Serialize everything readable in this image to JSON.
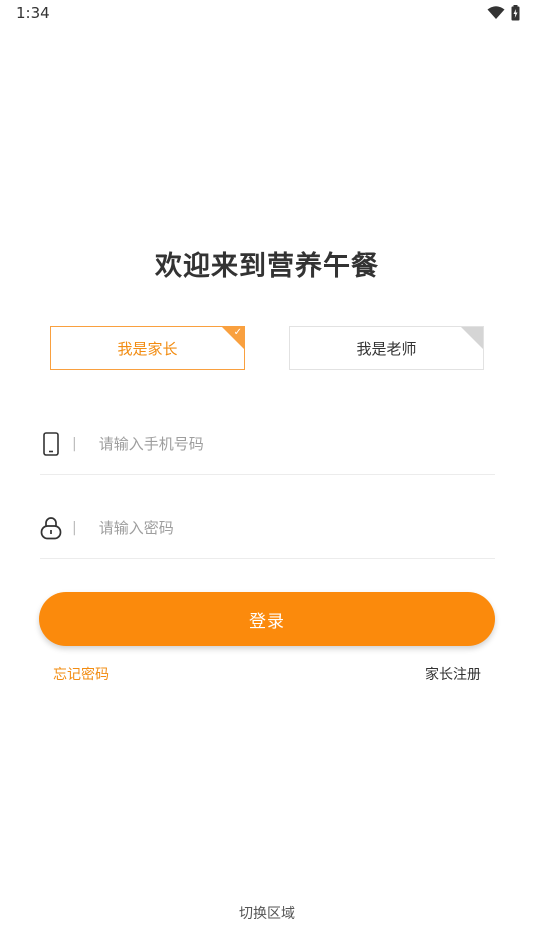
{
  "status_bar": {
    "time": "1:34",
    "wifi_icon": "wifi-icon",
    "battery_icon": "battery-charging-icon"
  },
  "title": "欢迎来到营养午餐",
  "roles": {
    "parent_label": "我是家长",
    "teacher_label": "我是老师",
    "selected": "parent"
  },
  "phone_input": {
    "icon": "mobile-phone-icon",
    "placeholder": "请输入手机号码",
    "value": ""
  },
  "password_input": {
    "icon": "lock-icon",
    "placeholder": "请输入密码",
    "value": ""
  },
  "login_label": "登录",
  "forgot_label": "忘记密码",
  "register_label": "家长注册",
  "switch_region_label": "切换区域",
  "colors": {
    "accent": "#fb8a0c",
    "accent_text": "#f28c12",
    "border_inactive": "#e2e2e2"
  }
}
